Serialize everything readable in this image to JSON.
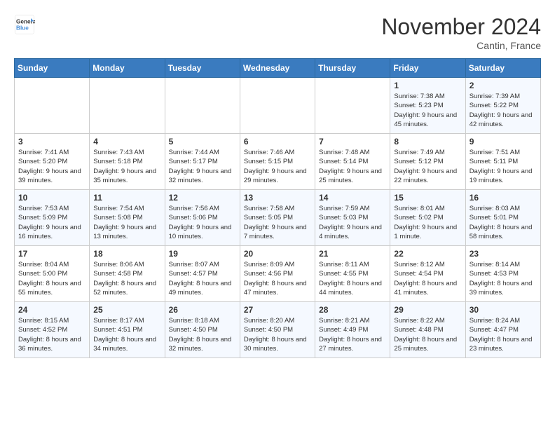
{
  "logo": {
    "line1": "General",
    "line2": "Blue"
  },
  "title": "November 2024",
  "location": "Cantin, France",
  "weekdays": [
    "Sunday",
    "Monday",
    "Tuesday",
    "Wednesday",
    "Thursday",
    "Friday",
    "Saturday"
  ],
  "weeks": [
    [
      {
        "day": "",
        "info": ""
      },
      {
        "day": "",
        "info": ""
      },
      {
        "day": "",
        "info": ""
      },
      {
        "day": "",
        "info": ""
      },
      {
        "day": "",
        "info": ""
      },
      {
        "day": "1",
        "info": "Sunrise: 7:38 AM\nSunset: 5:23 PM\nDaylight: 9 hours and 45 minutes."
      },
      {
        "day": "2",
        "info": "Sunrise: 7:39 AM\nSunset: 5:22 PM\nDaylight: 9 hours and 42 minutes."
      }
    ],
    [
      {
        "day": "3",
        "info": "Sunrise: 7:41 AM\nSunset: 5:20 PM\nDaylight: 9 hours and 39 minutes."
      },
      {
        "day": "4",
        "info": "Sunrise: 7:43 AM\nSunset: 5:18 PM\nDaylight: 9 hours and 35 minutes."
      },
      {
        "day": "5",
        "info": "Sunrise: 7:44 AM\nSunset: 5:17 PM\nDaylight: 9 hours and 32 minutes."
      },
      {
        "day": "6",
        "info": "Sunrise: 7:46 AM\nSunset: 5:15 PM\nDaylight: 9 hours and 29 minutes."
      },
      {
        "day": "7",
        "info": "Sunrise: 7:48 AM\nSunset: 5:14 PM\nDaylight: 9 hours and 25 minutes."
      },
      {
        "day": "8",
        "info": "Sunrise: 7:49 AM\nSunset: 5:12 PM\nDaylight: 9 hours and 22 minutes."
      },
      {
        "day": "9",
        "info": "Sunrise: 7:51 AM\nSunset: 5:11 PM\nDaylight: 9 hours and 19 minutes."
      }
    ],
    [
      {
        "day": "10",
        "info": "Sunrise: 7:53 AM\nSunset: 5:09 PM\nDaylight: 9 hours and 16 minutes."
      },
      {
        "day": "11",
        "info": "Sunrise: 7:54 AM\nSunset: 5:08 PM\nDaylight: 9 hours and 13 minutes."
      },
      {
        "day": "12",
        "info": "Sunrise: 7:56 AM\nSunset: 5:06 PM\nDaylight: 9 hours and 10 minutes."
      },
      {
        "day": "13",
        "info": "Sunrise: 7:58 AM\nSunset: 5:05 PM\nDaylight: 9 hours and 7 minutes."
      },
      {
        "day": "14",
        "info": "Sunrise: 7:59 AM\nSunset: 5:03 PM\nDaylight: 9 hours and 4 minutes."
      },
      {
        "day": "15",
        "info": "Sunrise: 8:01 AM\nSunset: 5:02 PM\nDaylight: 9 hours and 1 minute."
      },
      {
        "day": "16",
        "info": "Sunrise: 8:03 AM\nSunset: 5:01 PM\nDaylight: 8 hours and 58 minutes."
      }
    ],
    [
      {
        "day": "17",
        "info": "Sunrise: 8:04 AM\nSunset: 5:00 PM\nDaylight: 8 hours and 55 minutes."
      },
      {
        "day": "18",
        "info": "Sunrise: 8:06 AM\nSunset: 4:58 PM\nDaylight: 8 hours and 52 minutes."
      },
      {
        "day": "19",
        "info": "Sunrise: 8:07 AM\nSunset: 4:57 PM\nDaylight: 8 hours and 49 minutes."
      },
      {
        "day": "20",
        "info": "Sunrise: 8:09 AM\nSunset: 4:56 PM\nDaylight: 8 hours and 47 minutes."
      },
      {
        "day": "21",
        "info": "Sunrise: 8:11 AM\nSunset: 4:55 PM\nDaylight: 8 hours and 44 minutes."
      },
      {
        "day": "22",
        "info": "Sunrise: 8:12 AM\nSunset: 4:54 PM\nDaylight: 8 hours and 41 minutes."
      },
      {
        "day": "23",
        "info": "Sunrise: 8:14 AM\nSunset: 4:53 PM\nDaylight: 8 hours and 39 minutes."
      }
    ],
    [
      {
        "day": "24",
        "info": "Sunrise: 8:15 AM\nSunset: 4:52 PM\nDaylight: 8 hours and 36 minutes."
      },
      {
        "day": "25",
        "info": "Sunrise: 8:17 AM\nSunset: 4:51 PM\nDaylight: 8 hours and 34 minutes."
      },
      {
        "day": "26",
        "info": "Sunrise: 8:18 AM\nSunset: 4:50 PM\nDaylight: 8 hours and 32 minutes."
      },
      {
        "day": "27",
        "info": "Sunrise: 8:20 AM\nSunset: 4:50 PM\nDaylight: 8 hours and 30 minutes."
      },
      {
        "day": "28",
        "info": "Sunrise: 8:21 AM\nSunset: 4:49 PM\nDaylight: 8 hours and 27 minutes."
      },
      {
        "day": "29",
        "info": "Sunrise: 8:22 AM\nSunset: 4:48 PM\nDaylight: 8 hours and 25 minutes."
      },
      {
        "day": "30",
        "info": "Sunrise: 8:24 AM\nSunset: 4:47 PM\nDaylight: 8 hours and 23 minutes."
      }
    ]
  ]
}
